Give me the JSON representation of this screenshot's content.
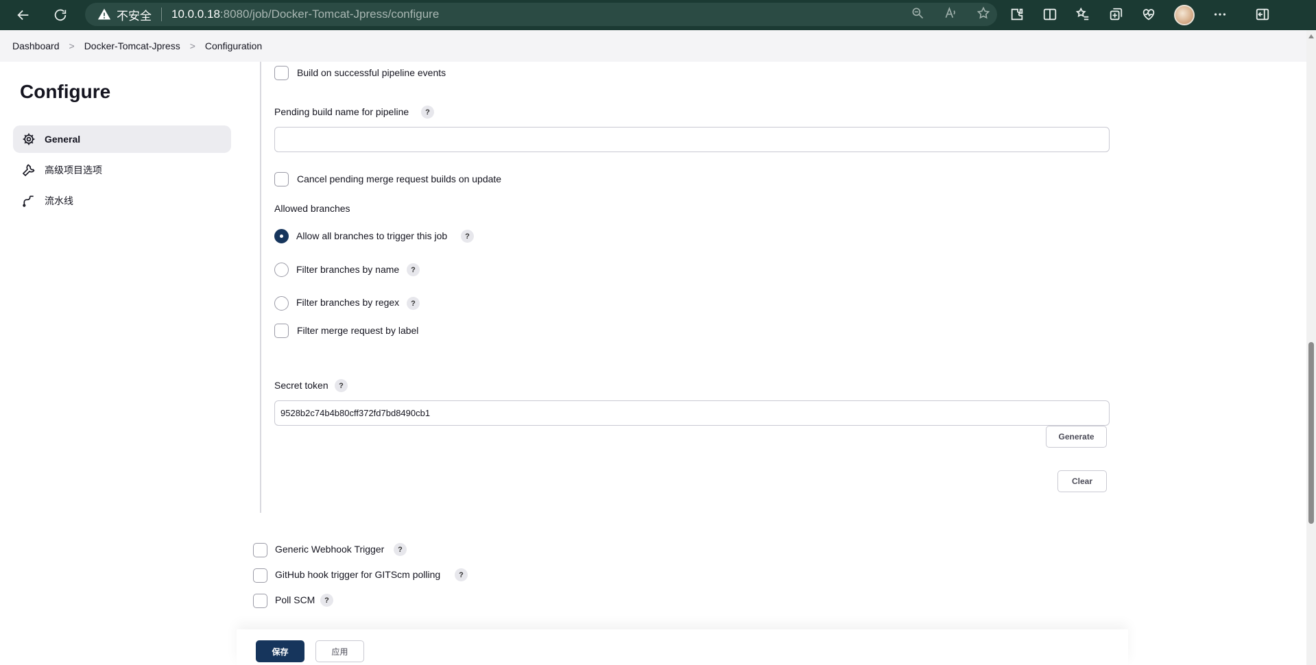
{
  "browser": {
    "insecure_label": "不安全",
    "url_host": "10.0.0.18",
    "url_rest": ":8080/job/Docker-Tomcat-Jpress/configure"
  },
  "breadcrumb": {
    "items": [
      "Dashboard",
      "Docker-Tomcat-Jpress",
      "Configuration"
    ],
    "separator": ">"
  },
  "sidebar": {
    "title": "Configure",
    "items": [
      {
        "label": "General",
        "icon": "gear-icon",
        "active": true
      },
      {
        "label": "高级项目选项",
        "icon": "wrench-icon",
        "active": false
      },
      {
        "label": "流水线",
        "icon": "pipeline-icon",
        "active": false
      }
    ]
  },
  "form": {
    "build_on_success_label": "Build on successful pipeline events",
    "pending_build_name_label": "Pending build name for pipeline",
    "pending_build_name_value": "",
    "cancel_pending_label": "Cancel pending merge request builds on update",
    "allowed_branches_label": "Allowed branches",
    "branch_options": [
      {
        "label": "Allow all branches to trigger this job",
        "checked": true
      },
      {
        "label": "Filter branches by name",
        "checked": false
      },
      {
        "label": "Filter branches by regex",
        "checked": false
      }
    ],
    "filter_mr_label": "Filter merge request by label",
    "secret_token_label": "Secret token",
    "secret_token_value": "9528b2c74b4b80cff372fd7bd8490cb1",
    "generate_label": "Generate",
    "clear_label": "Clear",
    "help_glyph": "?"
  },
  "triggers": [
    {
      "label": "Generic Webhook Trigger"
    },
    {
      "label": "GitHub hook trigger for GITScm polling"
    },
    {
      "label": "Poll SCM"
    }
  ],
  "footer": {
    "save_label": "保存",
    "apply_label": "应用"
  }
}
